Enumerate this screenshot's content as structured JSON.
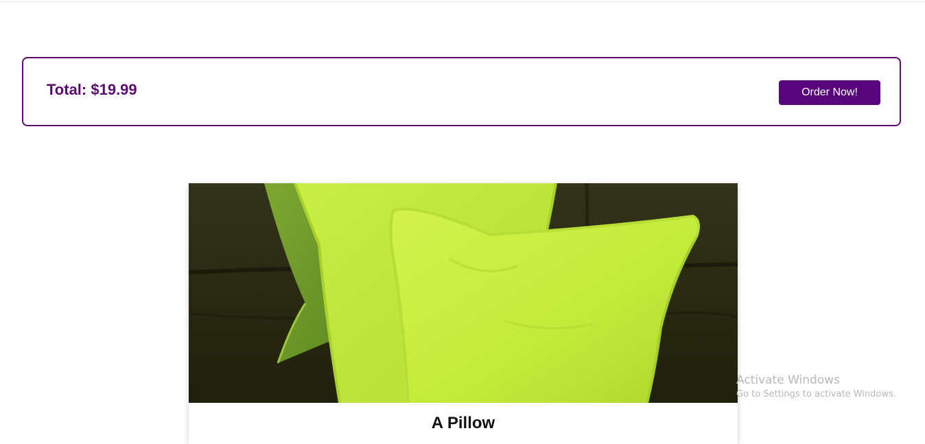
{
  "cart": {
    "total_label": "Total: $19.99",
    "order_button_label": "Order Now!"
  },
  "product": {
    "title": "A Pillow",
    "image_desc_icon": "pillows-photo"
  },
  "watermark": {
    "title": "Activate Windows",
    "subtitle": "Go to Settings to activate Windows."
  },
  "colors": {
    "accent": "#5b0a6e",
    "button_bg": "#56057a",
    "pillow_green": "#c4ec3e",
    "sofa_dark": "#2b2a10"
  }
}
